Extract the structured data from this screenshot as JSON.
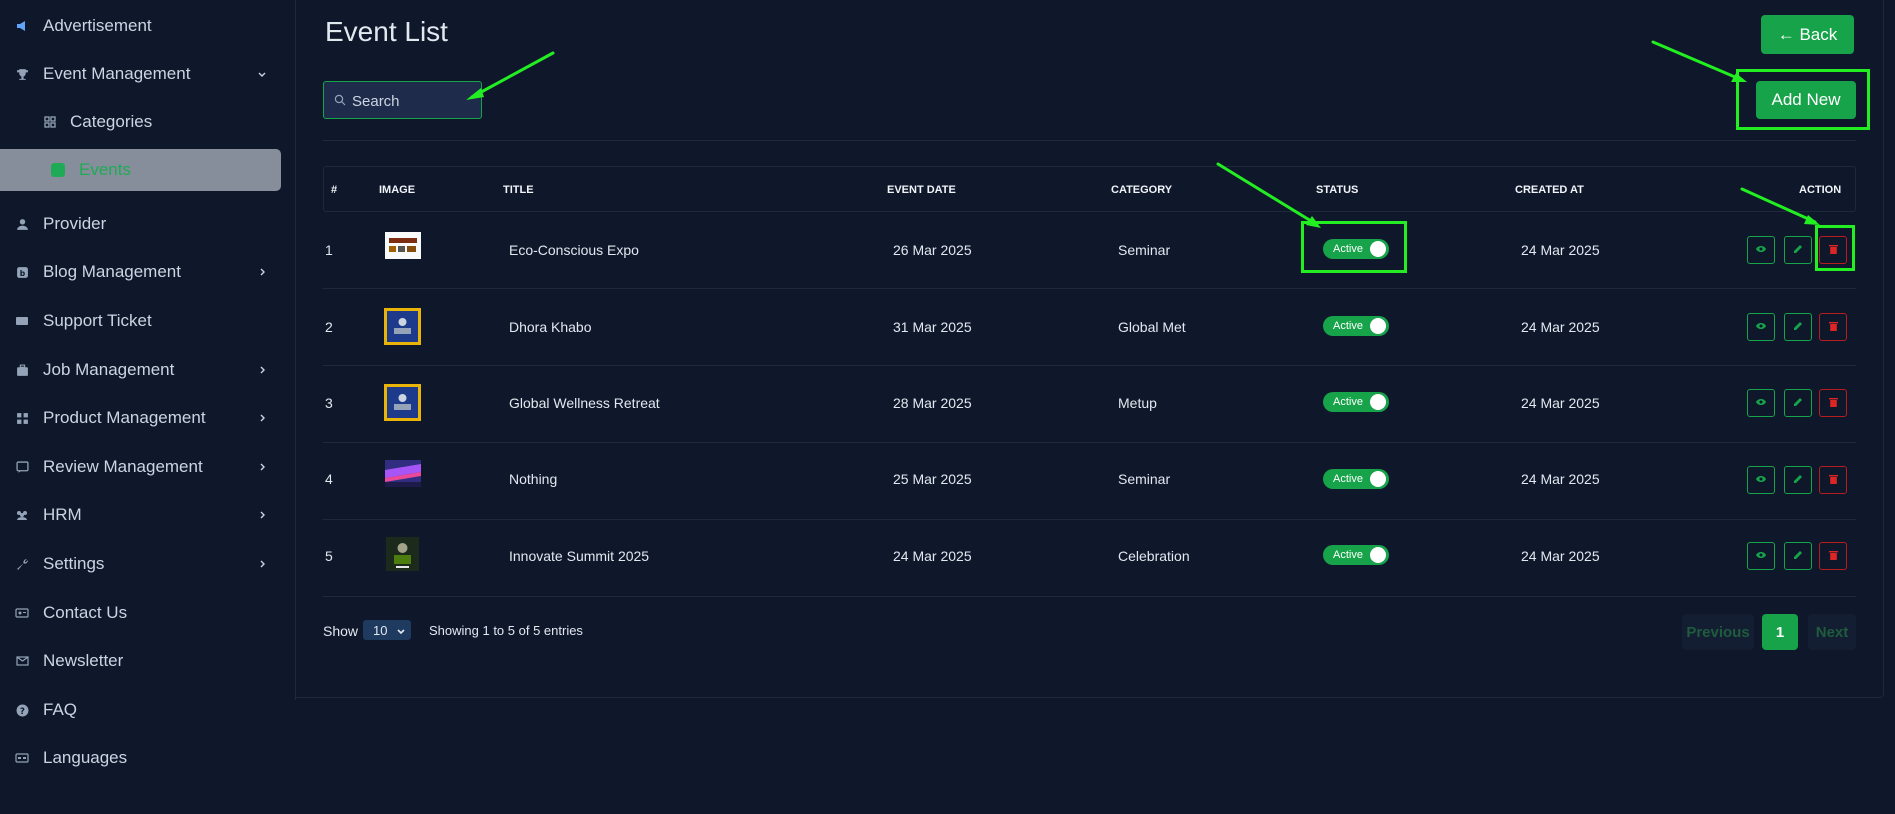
{
  "sidebar": {
    "items": [
      {
        "label": "Advertisement",
        "icon": "megaphone-icon"
      },
      {
        "label": "Event Management",
        "icon": "trophy-icon"
      },
      {
        "label": "Categories",
        "icon": "grid-icon"
      },
      {
        "label": "Events",
        "icon": "square-icon"
      },
      {
        "label": "Provider",
        "icon": "user-icon"
      },
      {
        "label": "Blog Management",
        "icon": "blog-icon"
      },
      {
        "label": "Support Ticket",
        "icon": "ticket-icon"
      },
      {
        "label": "Job Management",
        "icon": "briefcase-icon"
      },
      {
        "label": "Product Management",
        "icon": "boxes-icon"
      },
      {
        "label": "Review Management",
        "icon": "review-icon"
      },
      {
        "label": "HRM",
        "icon": "people-icon"
      },
      {
        "label": "Settings",
        "icon": "wrench-icon"
      },
      {
        "label": "Contact Us",
        "icon": "contact-card-icon"
      },
      {
        "label": "Newsletter",
        "icon": "envelope-icon"
      },
      {
        "label": "FAQ",
        "icon": "question-icon"
      },
      {
        "label": "Languages",
        "icon": "language-icon"
      }
    ]
  },
  "header": {
    "title": "Event List",
    "back_label": "← Back",
    "add_label": "Add New"
  },
  "search": {
    "placeholder": "Search"
  },
  "table": {
    "columns": [
      "#",
      "IMAGE",
      "TITLE",
      "EVENT DATE",
      "CATEGORY",
      "STATUS",
      "CREATED AT",
      "ACTION"
    ],
    "rows": [
      {
        "num": "1",
        "title": "Eco-Conscious Expo",
        "event_date": "26 Mar 2025",
        "category": "Seminar",
        "status": "Active",
        "created_at": "24 Mar 2025"
      },
      {
        "num": "2",
        "title": "Dhora Khabo",
        "event_date": "31 Mar 2025",
        "category": "Global Met",
        "status": "Active",
        "created_at": "24 Mar 2025"
      },
      {
        "num": "3",
        "title": "Global Wellness Retreat",
        "event_date": "28 Mar 2025",
        "category": "Metup",
        "status": "Active",
        "created_at": "24 Mar 2025"
      },
      {
        "num": "4",
        "title": "Nothing",
        "event_date": "25 Mar 2025",
        "category": "Seminar",
        "status": "Active",
        "created_at": "24 Mar 2025"
      },
      {
        "num": "5",
        "title": "Innovate Summit 2025",
        "event_date": "24 Mar 2025",
        "category": "Celebration",
        "status": "Active",
        "created_at": "24 Mar 2025"
      }
    ]
  },
  "footer": {
    "show_label": "Show",
    "page_size": "10",
    "info": "Showing 1 to 5 of 5 entries",
    "prev_label": "Previous",
    "current_page": "1",
    "next_label": "Next"
  },
  "colors": {
    "background": "#0f172a",
    "accent": "#16a34a",
    "danger": "#dc2626",
    "annotation": "#22ee22"
  }
}
